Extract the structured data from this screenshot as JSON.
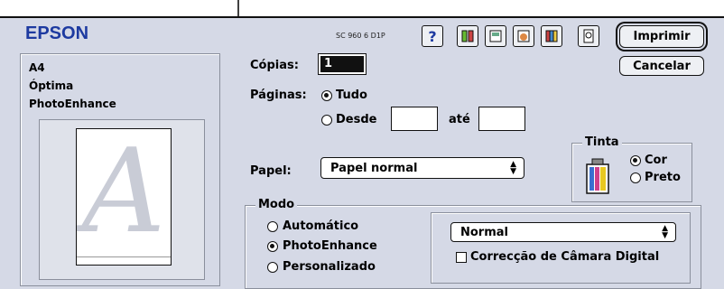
{
  "brand": {
    "logo": "EPSON",
    "model": "SC 960 6 D1P"
  },
  "toolbar": {
    "help_icon": "?",
    "print_button": "Imprimir",
    "cancel_button": "Cancelar"
  },
  "summary": {
    "paper_size": "A4",
    "quality": "Óptima",
    "mode": "PhotoEnhance",
    "preview_letter": "A"
  },
  "copies": {
    "label": "Cópias:",
    "value": "1"
  },
  "pages": {
    "label": "Páginas:",
    "all": "Tudo",
    "from": "Desde",
    "to": "até",
    "from_value": "",
    "to_value": "",
    "selected": "all"
  },
  "ink": {
    "title": "Tinta",
    "color": "Cor",
    "black": "Preto",
    "selected": "color"
  },
  "paper": {
    "label": "Papel:",
    "value": "Papel normal"
  },
  "mode": {
    "title": "Modo",
    "automatic": "Automático",
    "photo_enhance": "PhotoEnhance",
    "custom": "Personalizado",
    "selected": "photo_enhance"
  },
  "enhance": {
    "tone": "Normal",
    "digital_camera": "Correcção de Câmara Digital",
    "digital_camera_checked": false
  }
}
